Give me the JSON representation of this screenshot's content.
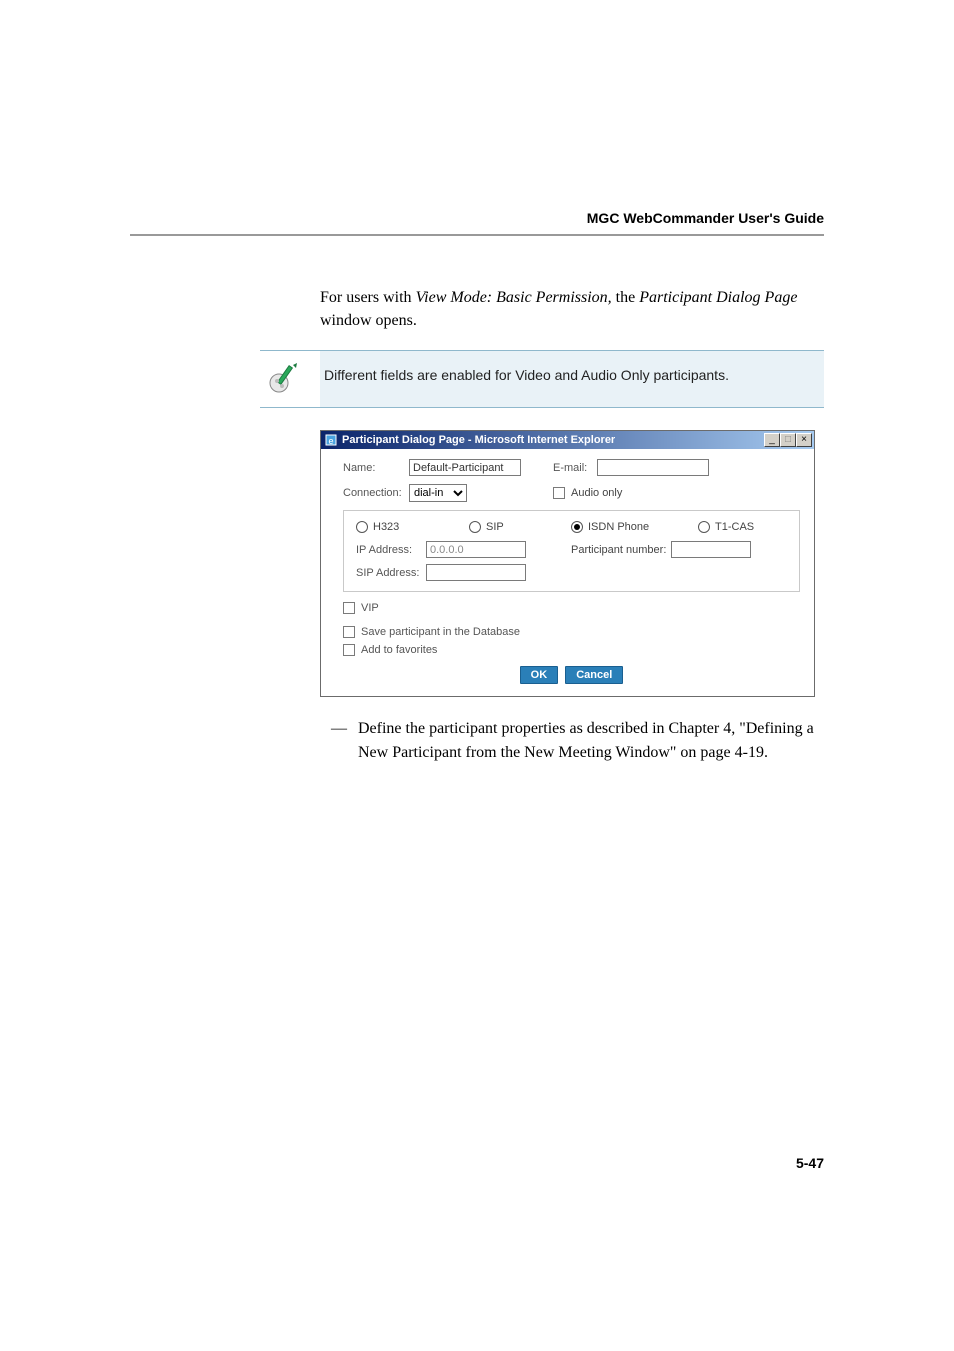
{
  "header": {
    "title": "MGC WebCommander User's Guide"
  },
  "intro": {
    "prefix": "For users with ",
    "italic1": "View Mode: Basic Permission,",
    "mid": " the ",
    "italic2": "Participant Dialog Page",
    "suffix": " window opens."
  },
  "note": {
    "text": "Different fields are enabled for Video and Audio Only participants."
  },
  "dialog": {
    "title": "Participant Dialog Page - Microsoft Internet Explorer",
    "labels": {
      "name": "Name:",
      "email": "E-mail:",
      "connection": "Connection:",
      "audio_only": "Audio only",
      "h323": "H323",
      "sip": "SIP",
      "isdn": "ISDN Phone",
      "t1cas": "T1-CAS",
      "ip_address": "IP Address:",
      "sip_address": "SIP Address:",
      "participant_number": "Participant number:",
      "vip": "VIP",
      "save_db": "Save participant in the Database",
      "add_fav": "Add to favorites"
    },
    "values": {
      "name": "Default-Participant",
      "connection_selected": "dial-in",
      "ip_address": "0.0.0.0",
      "sip_address": "",
      "email": "",
      "participant_number": ""
    },
    "radio_selected": "isdn",
    "buttons": {
      "ok": "OK",
      "cancel": "Cancel"
    },
    "window_controls": {
      "minimize": "_",
      "maximize": "□",
      "close": "×"
    }
  },
  "bullet": {
    "dash": "—",
    "text": "Define the participant properties as described in Chapter  4, \"Defining a New Participant from the New Meeting Window\" on page 4-19."
  },
  "page_number": "5-47"
}
